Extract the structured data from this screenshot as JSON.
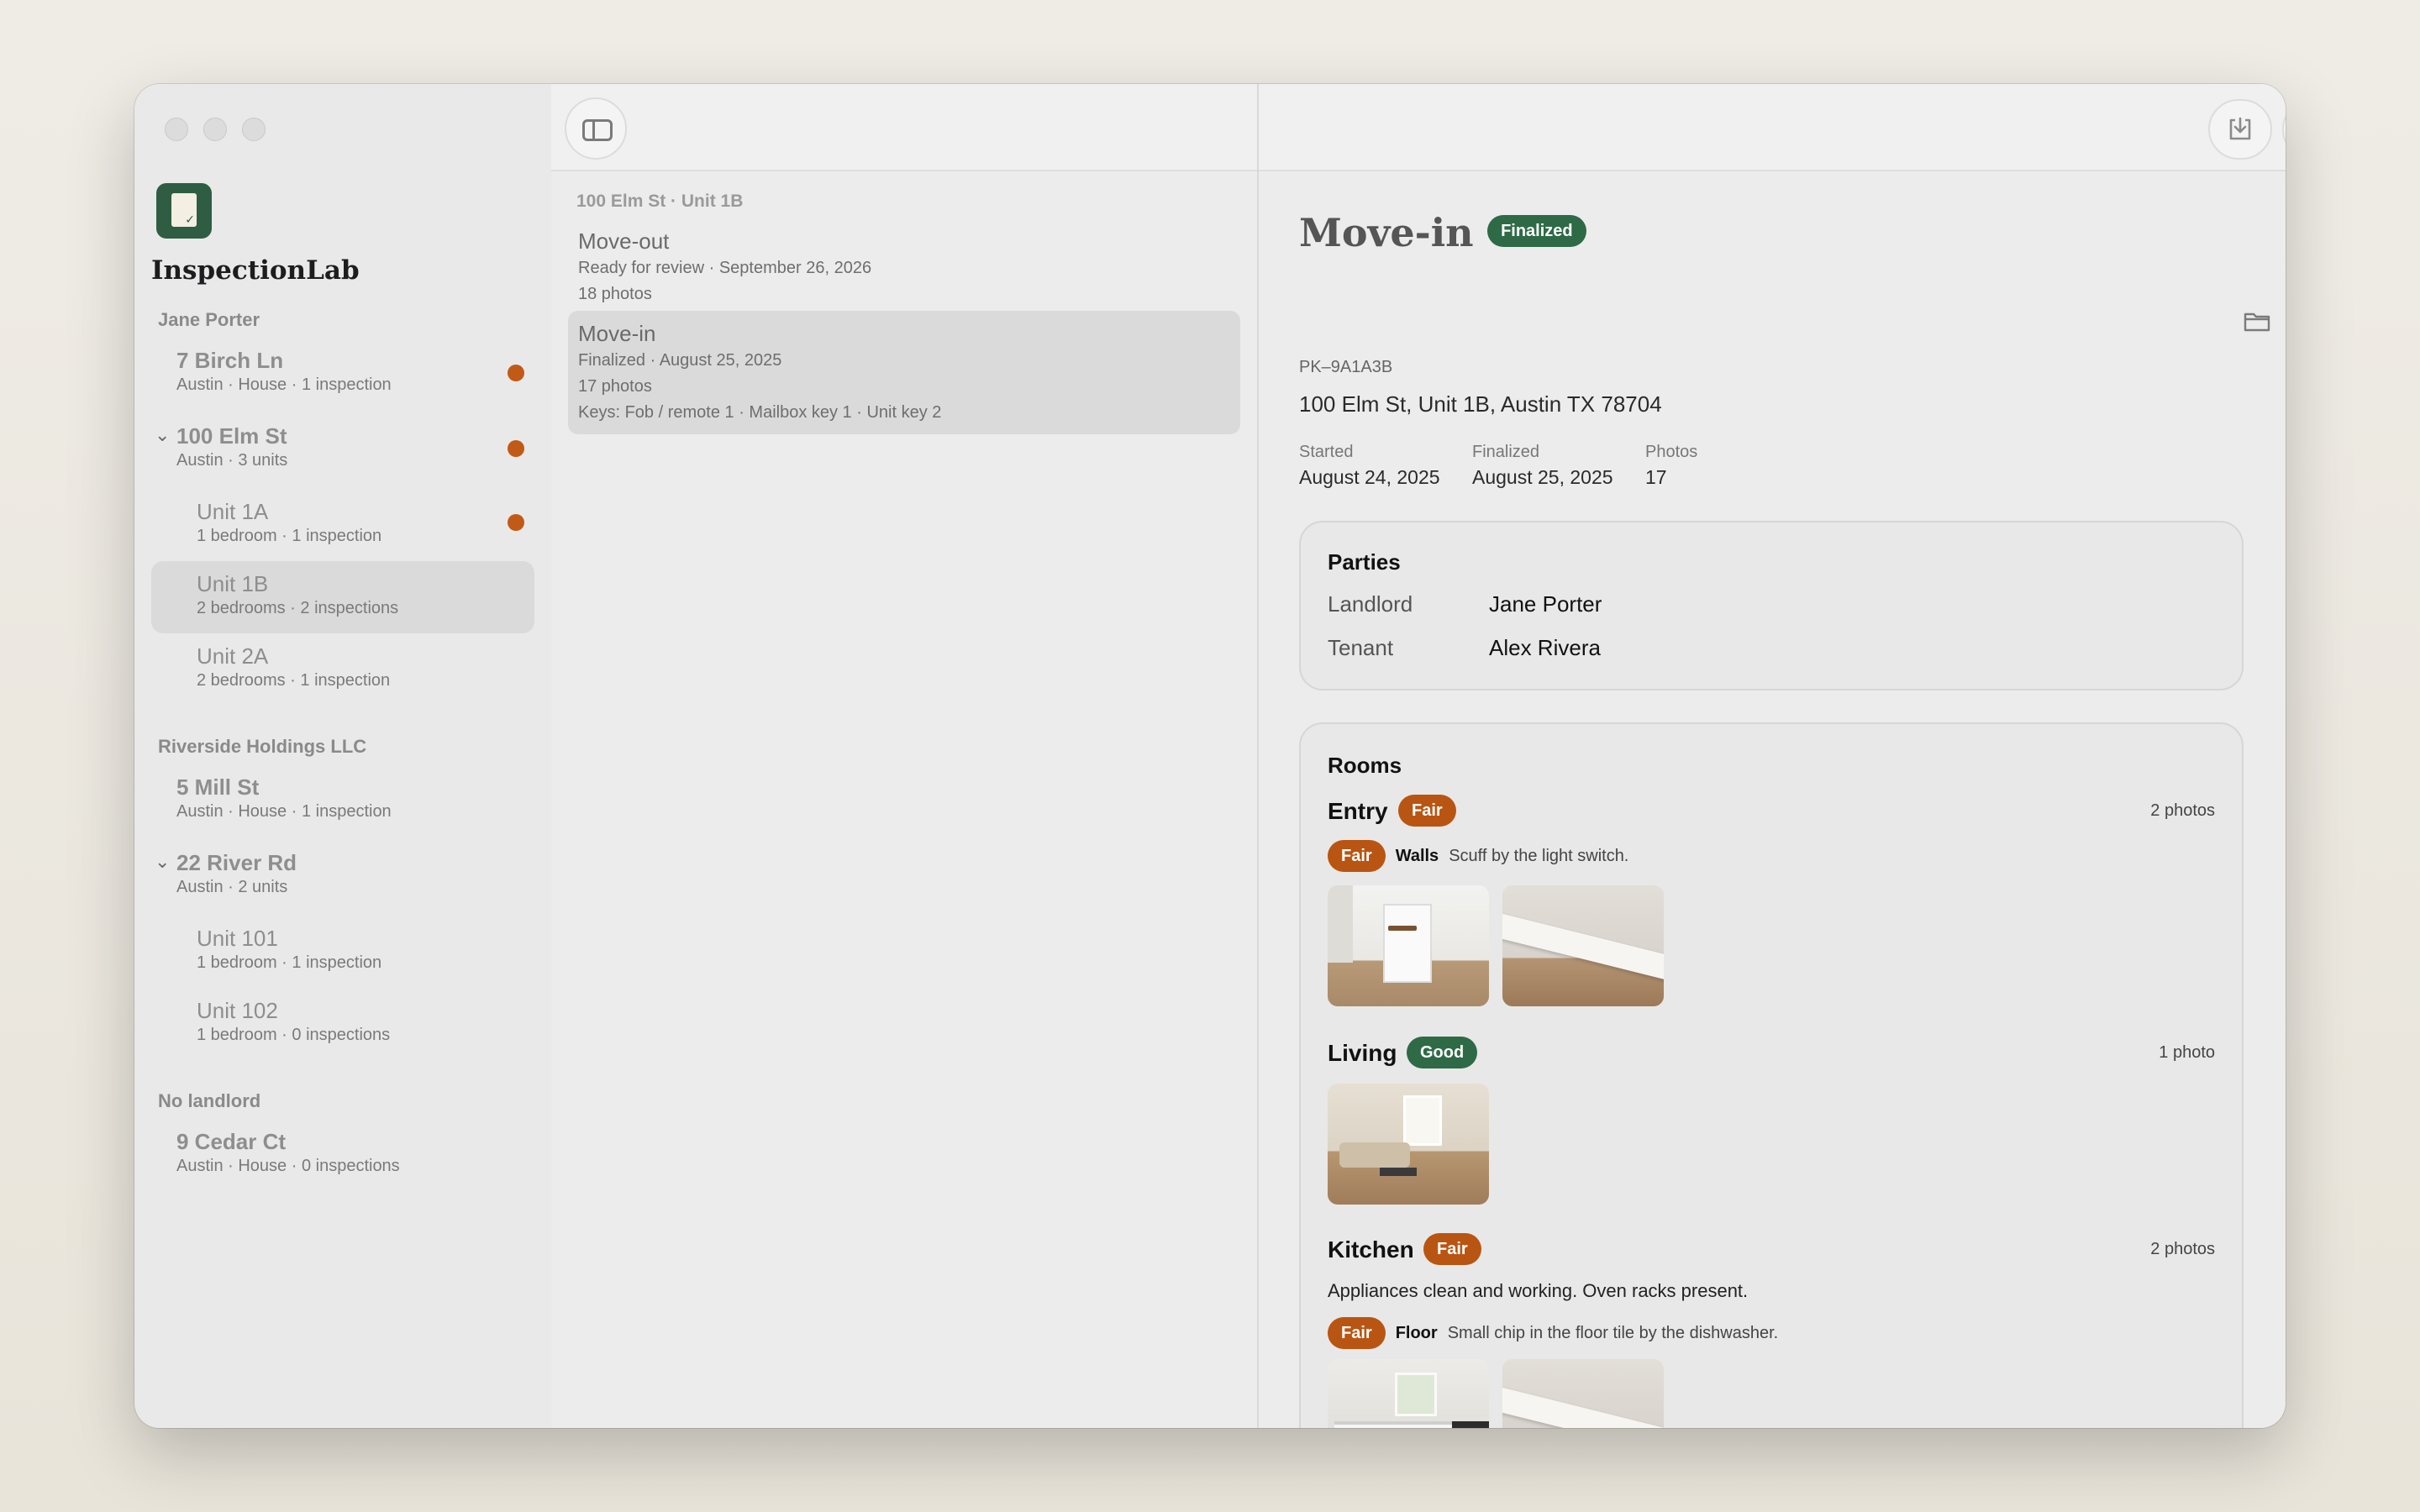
{
  "app": {
    "name": "InspectionLab"
  },
  "sidebar": {
    "groups": [
      {
        "title": "Jane Porter",
        "items": [
          {
            "title": "7 Birch Ln",
            "subtitle": "Austin · House · 1 inspection",
            "dot": true
          },
          {
            "title": "100 Elm St",
            "subtitle": "Austin · 3 units",
            "dot": true,
            "expanded": true
          },
          {
            "title": "Unit 1A",
            "subtitle": "1 bedroom · 1 inspection",
            "dot": true,
            "unit": true
          },
          {
            "title": "Unit 1B",
            "subtitle": "2 bedrooms · 2 inspections",
            "unit": true,
            "selected": true
          },
          {
            "title": "Unit 2A",
            "subtitle": "2 bedrooms · 1 inspection",
            "unit": true
          }
        ]
      },
      {
        "title": "Riverside Holdings LLC",
        "items": [
          {
            "title": "5 Mill St",
            "subtitle": "Austin · House · 1 inspection"
          },
          {
            "title": "22 River Rd",
            "subtitle": "Austin · 2 units",
            "expanded": true
          },
          {
            "title": "Unit 101",
            "subtitle": "1 bedroom · 1 inspection",
            "unit": true
          },
          {
            "title": "Unit 102",
            "subtitle": "1 bedroom · 0 inspections",
            "unit": true
          }
        ]
      },
      {
        "title": "No landlord",
        "items": [
          {
            "title": "9 Cedar Ct",
            "subtitle": "Austin · House · 0 inspections"
          }
        ]
      }
    ]
  },
  "middle": {
    "breadcrumb": "100 Elm St · Unit 1B",
    "inspections": [
      {
        "title": "Move-out",
        "line1": "Ready for review · September 26, 2026",
        "line2": "18 photos"
      },
      {
        "title": "Move-in",
        "line1": "Finalized · August 25, 2025",
        "line2": "17 photos",
        "line3": "Keys: Fob / remote 1 · Mailbox key 1 · Unit key 2",
        "selected": true
      }
    ]
  },
  "detail": {
    "title": "Move-in",
    "status": "Finalized",
    "code": "PK–9A1A3B",
    "address": "100 Elm St, Unit 1B, Austin TX 78704",
    "meta": [
      {
        "label": "Started",
        "value": "August 24, 2025"
      },
      {
        "label": "Finalized",
        "value": "August 25, 2025"
      },
      {
        "label": "Photos",
        "value": "17"
      }
    ],
    "parties": {
      "title": "Parties",
      "rows": [
        {
          "role": "Landlord",
          "name": "Jane Porter"
        },
        {
          "role": "Tenant",
          "name": "Alex Rivera"
        }
      ]
    },
    "rooms": {
      "title": "Rooms",
      "list": [
        {
          "name": "Entry",
          "rating": "Fair",
          "photos": "2 photos",
          "issue": {
            "rating": "Fair",
            "area": "Walls",
            "text": "Scuff by the light switch."
          }
        },
        {
          "name": "Living",
          "rating": "Good",
          "photos": "1 photo"
        },
        {
          "name": "Kitchen",
          "rating": "Fair",
          "photos": "2 photos",
          "note": "Appliances clean and working. Oven racks present.",
          "issue": {
            "rating": "Fair",
            "area": "Floor",
            "text": "Small chip in the floor tile by the dishwasher."
          }
        }
      ]
    }
  },
  "colors": {
    "accent_green": "#2e6a46",
    "accent_orange": "#b95512",
    "dot": "#c15a16"
  },
  "icons": [
    "sidebar-toggle-icon",
    "download-icon",
    "plus-icon",
    "chevron-down-icon",
    "folder-icon",
    "eye-icon",
    "printer-icon"
  ]
}
